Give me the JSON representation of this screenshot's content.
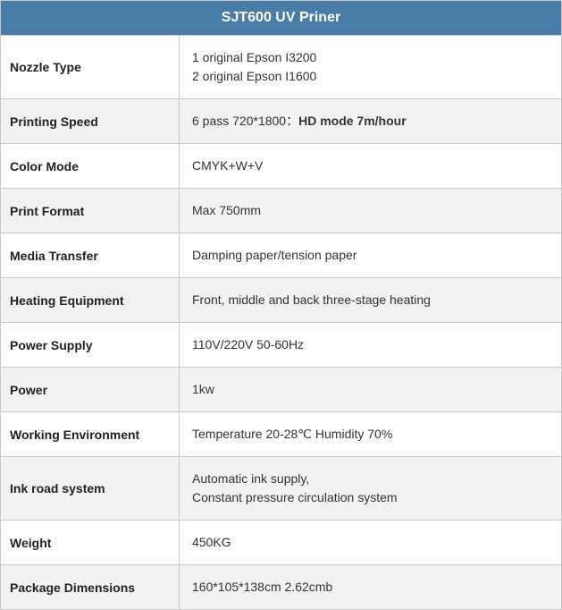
{
  "title": "SJT600 UV Priner",
  "rows": [
    {
      "id": "nozzle-type",
      "label": "Nozzle Type",
      "value": "1 original Epson I3200\n2 original Epson I1600",
      "bold_suffix": null
    },
    {
      "id": "printing-speed",
      "label": "Printing Speed",
      "value": "6 pass 720*1800：",
      "bold_suffix": "HD mode 7m/hour"
    },
    {
      "id": "color-mode",
      "label": "Color Mode",
      "value": "CMYK+W+V",
      "bold_suffix": null
    },
    {
      "id": "print-format",
      "label": "Print Format",
      "value": "Max 750mm",
      "bold_suffix": null
    },
    {
      "id": "media-transfer",
      "label": "Media Transfer",
      "value": "Damping paper/tension paper",
      "bold_suffix": null
    },
    {
      "id": "heating-equipment",
      "label": "Heating Equipment",
      "value": "Front, middle and back three-stage heating",
      "bold_suffix": null
    },
    {
      "id": "power-supply",
      "label": "Power Supply",
      "value": "110V/220V 50-60Hz",
      "bold_suffix": null
    },
    {
      "id": "power",
      "label": "Power",
      "value": "1kw",
      "bold_suffix": null
    },
    {
      "id": "working-environment",
      "label": "Working Environment",
      "value": "Temperature 20-28℃ Humidity 70%",
      "bold_suffix": null
    },
    {
      "id": "ink-road-system",
      "label": "Ink road system",
      "value": "Automatic ink supply,\nConstant pressure circulation system",
      "bold_suffix": null
    },
    {
      "id": "weight",
      "label": "Weight",
      "value": "450KG",
      "bold_suffix": null
    },
    {
      "id": "package-dimensions",
      "label": "Package Dimensions",
      "value": "160*105*138cm 2.62cmb",
      "bold_suffix": null
    }
  ]
}
